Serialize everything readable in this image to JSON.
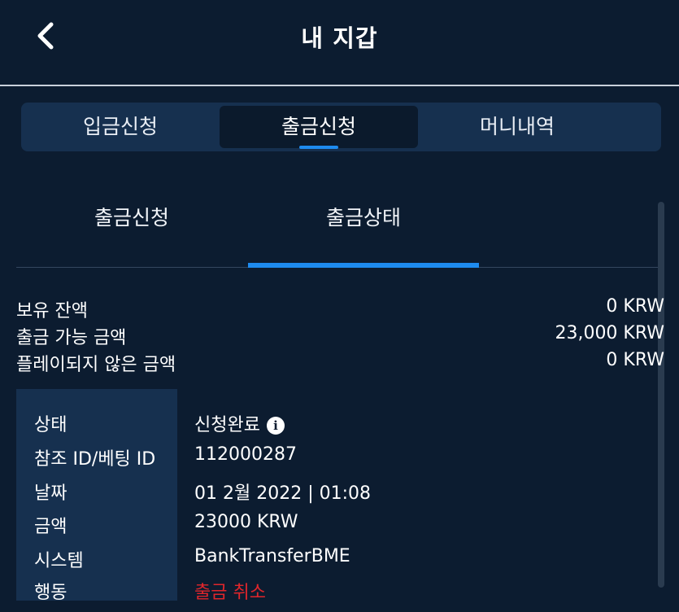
{
  "header": {
    "title": "내 지갑"
  },
  "tabs": [
    {
      "label": "입금신청",
      "active": false
    },
    {
      "label": "출금신청",
      "active": true
    },
    {
      "label": "머니내역",
      "active": false
    }
  ],
  "sub_tabs": [
    {
      "label": "출금신청",
      "active": false
    },
    {
      "label": "출금상태",
      "active": true
    }
  ],
  "balances": [
    {
      "label": "보유 잔액",
      "value": "0 KRW"
    },
    {
      "label": "출금 가능 금액",
      "value": "23,000 KRW"
    },
    {
      "label": "플레이되지 않은 금액",
      "value": "0 KRW"
    }
  ],
  "detail": {
    "status_label": "상태",
    "status_value": "신청완료",
    "ref_label": "참조 ID/베팅 ID",
    "ref_value": "112000287",
    "date_label": "날짜",
    "date_value": "01 2월 2022 | 01:08",
    "amount_label": "금액",
    "amount_value": "23000 KRW",
    "system_label": "시스템",
    "system_value": "BankTransferBME",
    "action_label": "행동",
    "action_value": "출금 취소"
  },
  "colors": {
    "background": "#0c1c30",
    "panel": "#16304f",
    "accent": "#1e8bef",
    "danger": "#e0262b"
  },
  "icons": {
    "back": "chevron-left-icon",
    "info": "info-circle-icon"
  }
}
